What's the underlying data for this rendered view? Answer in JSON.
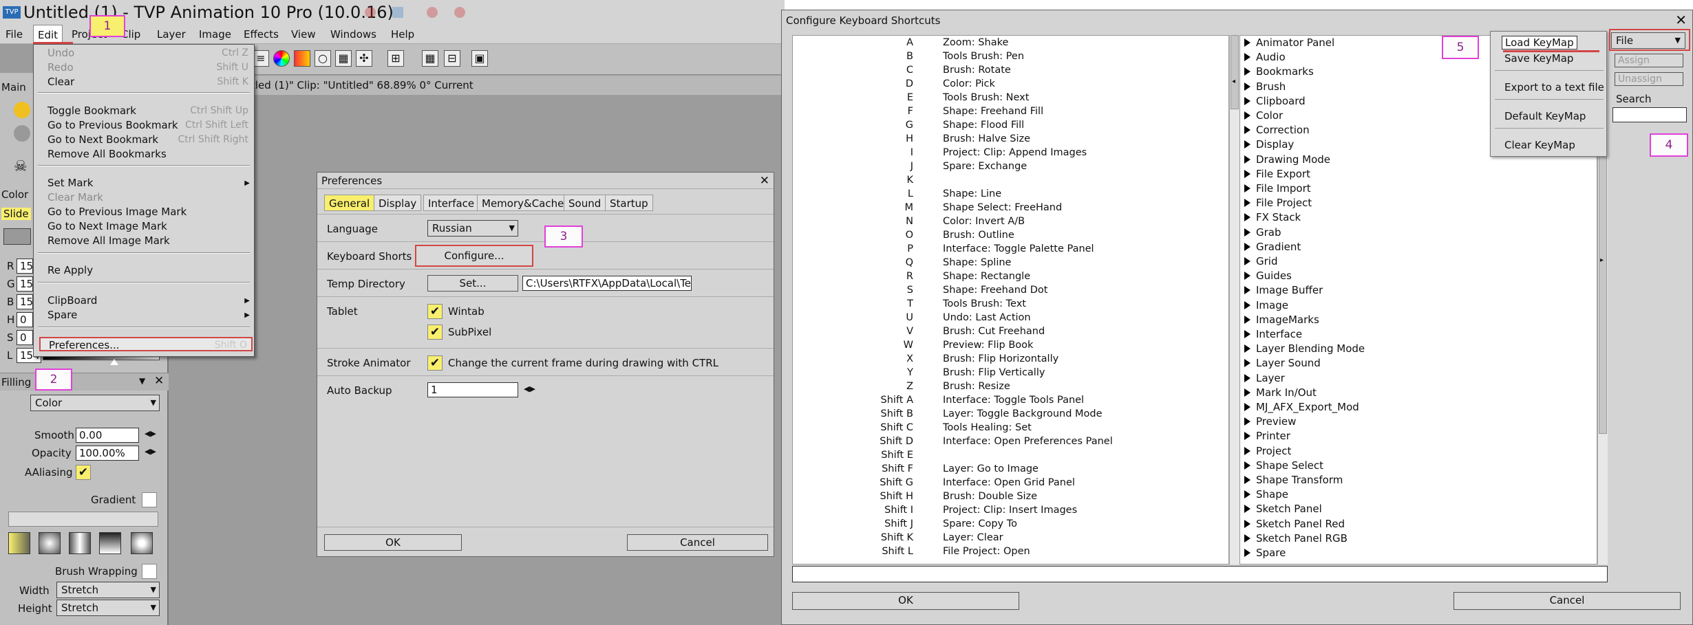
{
  "app": {
    "title": "Untitled (1) - TVP Animation 10 Pro (10.0.16)",
    "icon_text": "TVP",
    "menus": [
      "File",
      "Edit",
      "Project",
      "Clip",
      "Layer",
      "Image",
      "Effects",
      "View",
      "Windows",
      "Help"
    ],
    "status_text": "tled (1)\"  Clip: \"Untitled\"  68.89%  0°  Current",
    "left_labels": {
      "main": "Main",
      "color": "Color",
      "slider": "Slide"
    }
  },
  "edit_menu": {
    "items": [
      {
        "label": "Undo",
        "shortcut": "Ctrl Z",
        "disabled": true
      },
      {
        "label": "Redo",
        "shortcut": "Shift U",
        "disabled": true
      },
      {
        "label": "Clear",
        "shortcut": "Shift K",
        "disabled": false
      },
      {
        "label": "Toggle Bookmark",
        "shortcut": "Ctrl Shift Up",
        "disabled": false
      },
      {
        "label": "Go to Previous Bookmark",
        "shortcut": "Ctrl Shift Left",
        "disabled": false
      },
      {
        "label": "Go to Next Bookmark",
        "shortcut": "Ctrl Shift Right",
        "disabled": false
      },
      {
        "label": "Remove All Bookmarks",
        "shortcut": "",
        "disabled": false
      },
      {
        "label": "Set Mark",
        "shortcut": "",
        "disabled": false,
        "submenu": true
      },
      {
        "label": "Clear Mark",
        "shortcut": "",
        "disabled": true
      },
      {
        "label": "Go to Previous Image Mark",
        "shortcut": "",
        "disabled": false
      },
      {
        "label": "Go to Next Image Mark",
        "shortcut": "",
        "disabled": false
      },
      {
        "label": "Remove All Image Mark",
        "shortcut": "",
        "disabled": false
      },
      {
        "label": "Re Apply",
        "shortcut": "",
        "disabled": false
      },
      {
        "label": "ClipBoard",
        "shortcut": "",
        "disabled": false,
        "submenu": true
      },
      {
        "label": "Spare",
        "shortcut": "",
        "disabled": false,
        "submenu": true
      },
      {
        "label": "Preferences...",
        "shortcut": "Shift O",
        "disabled": false
      }
    ]
  },
  "color_panel": {
    "channels": [
      {
        "label": "R",
        "value": "15"
      },
      {
        "label": "G",
        "value": "15"
      },
      {
        "label": "B",
        "value": "15"
      },
      {
        "label": "H",
        "value": "0"
      },
      {
        "label": "S",
        "value": "0"
      },
      {
        "label": "L",
        "value": "154"
      }
    ]
  },
  "filling_panel": {
    "title": "Filling",
    "mode": "Color",
    "smooth_label": "Smooth",
    "smooth_value": "0.00",
    "opacity_label": "Opacity",
    "opacity_value": "100.00%",
    "aaliasing_label": "AAliasing",
    "gradient_label": "Gradient",
    "brush_wrapping_label": "Brush Wrapping",
    "width_label": "Width",
    "width_value": "Stretch",
    "height_label": "Height",
    "height_value": "Stretch"
  },
  "preferences": {
    "title": "Preferences",
    "tabs": [
      "General",
      "Display",
      "Interface",
      "Memory&Cache",
      "Sound",
      "Startup"
    ],
    "language_label": "Language",
    "language_value": "Russian",
    "keyboard_label": "Keyboard Shorts",
    "configure_button": "Configure...",
    "temp_label": "Temp Directory",
    "set_button": "Set...",
    "temp_value": "C:\\Users\\RTFX\\AppData\\Local\\Te",
    "tablet_label": "Tablet",
    "wintab_label": "Wintab",
    "subpixel_label": "SubPixel",
    "stroke_label": "Stroke Animator",
    "stroke_option": "Change the current frame during drawing with CTRL",
    "backup_label": "Auto Backup",
    "backup_value": "1",
    "ok_button": "OK",
    "cancel_button": "Cancel"
  },
  "shortcuts": {
    "title": "Configure Keyboard Shortcuts",
    "rows": [
      {
        "key": "A",
        "action": "Zoom: Shake"
      },
      {
        "key": "B",
        "action": "Tools Brush: Pen"
      },
      {
        "key": "C",
        "action": "Brush: Rotate"
      },
      {
        "key": "D",
        "action": "Color: Pick"
      },
      {
        "key": "E",
        "action": "Tools Brush: Next"
      },
      {
        "key": "F",
        "action": "Shape: Freehand Fill"
      },
      {
        "key": "G",
        "action": "Shape: Flood Fill"
      },
      {
        "key": "H",
        "action": "Brush: Halve Size"
      },
      {
        "key": "I",
        "action": "Project: Clip: Append Images"
      },
      {
        "key": "J",
        "action": "Spare: Exchange"
      },
      {
        "key": "K",
        "action": ""
      },
      {
        "key": "L",
        "action": "Shape: Line"
      },
      {
        "key": "M",
        "action": "Shape Select: FreeHand"
      },
      {
        "key": "N",
        "action": "Color: Invert A/B"
      },
      {
        "key": "O",
        "action": "Brush: Outline"
      },
      {
        "key": "P",
        "action": "Interface: Toggle Palette Panel"
      },
      {
        "key": "Q",
        "action": "Shape: Spline"
      },
      {
        "key": "R",
        "action": "Shape: Rectangle"
      },
      {
        "key": "S",
        "action": "Shape: Freehand Dot"
      },
      {
        "key": "T",
        "action": "Tools Brush: Text"
      },
      {
        "key": "U",
        "action": "Undo: Last Action"
      },
      {
        "key": "V",
        "action": "Brush: Cut Freehand"
      },
      {
        "key": "W",
        "action": "Preview: Flip Book"
      },
      {
        "key": "X",
        "action": "Brush: Flip Horizontally"
      },
      {
        "key": "Y",
        "action": "Brush: Flip Vertically"
      },
      {
        "key": "Z",
        "action": "Brush: Resize"
      },
      {
        "key": "Shift A",
        "action": "Interface: Toggle Tools Panel"
      },
      {
        "key": "Shift B",
        "action": "Layer: Toggle Background Mode"
      },
      {
        "key": "Shift C",
        "action": "Tools Healing: Set"
      },
      {
        "key": "Shift D",
        "action": "Interface: Open Preferences Panel"
      },
      {
        "key": "Shift E",
        "action": ""
      },
      {
        "key": "Shift F",
        "action": "Layer: Go to Image"
      },
      {
        "key": "Shift G",
        "action": "Interface: Open Grid Panel"
      },
      {
        "key": "Shift H",
        "action": "Brush: Double Size"
      },
      {
        "key": "Shift I",
        "action": "Project: Clip: Insert Images"
      },
      {
        "key": "Shift J",
        "action": "Spare: Copy To"
      },
      {
        "key": "Shift K",
        "action": "Layer: Clear"
      },
      {
        "key": "Shift L",
        "action": "File Project: Open"
      }
    ],
    "categories": [
      "Animator Panel",
      "Audio",
      "Bookmarks",
      "Brush",
      "Clipboard",
      "Color",
      "Correction",
      "Display",
      "Drawing Mode",
      "File Export",
      "File Import",
      "File Project",
      "FX Stack",
      "Grab",
      "Gradient",
      "Grid",
      "Guides",
      "Image Buffer",
      "Image",
      "ImageMarks",
      "Interface",
      "Layer Blending Mode",
      "Layer Sound",
      "Layer",
      "Mark In/Out",
      "MJ_AFX_Export_Mod",
      "Preview",
      "Printer",
      "Project",
      "Shape Select",
      "Shape Transform",
      "Shape",
      "Sketch Panel",
      "Sketch Panel Red",
      "Sketch Panel RGB",
      "Spare"
    ],
    "file_button": "File",
    "assign_button": "Assign",
    "unassign_button": "Unassign",
    "search_label": "Search",
    "file_menu": [
      "Load KeyMap",
      "Save KeyMap",
      "Export to a text file",
      "Default KeyMap",
      "Clear KeyMap"
    ],
    "ok_button": "OK",
    "cancel_button": "Cancel"
  },
  "annotations": [
    "1",
    "2",
    "3",
    "4",
    "5"
  ],
  "colors": {
    "accent_yellow": "#f8ef6e",
    "annotation": "#e23fd8",
    "highlight_red": "#d24545"
  }
}
